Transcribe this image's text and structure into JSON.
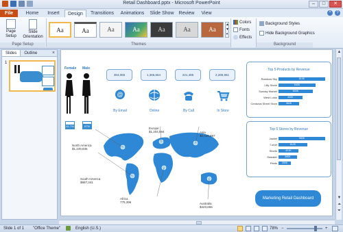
{
  "window": {
    "title": "Retail Dashboard.pptx - Microsoft PowerPoint",
    "minimize": "–",
    "maximize": "□",
    "close": "✕"
  },
  "ribbon_tabs": [
    "File",
    "Home",
    "Insert",
    "Design",
    "Transitions",
    "Animations",
    "Slide Show",
    "Review",
    "View"
  ],
  "ribbon": {
    "page_setup": {
      "btn1": "Page Setup",
      "btn2": "Slide Orientation",
      "group": "Page Setup"
    },
    "themes": {
      "group": "Themes",
      "sample": "Aa"
    },
    "theme_options": {
      "colors": "Colors",
      "fonts": "Fonts",
      "effects": "Effects"
    },
    "background": {
      "styles": "Background Styles",
      "hide": "Hide Background Graphics",
      "group": "Background"
    }
  },
  "left_pane": {
    "tab_slides": "Slides",
    "tab_outline": "Outline",
    "close": "×",
    "slide_number": "1"
  },
  "slide": {
    "female_label": "Female",
    "male_label": "Male",
    "female_pct": "61.7%",
    "male_pct": "67%",
    "female_fill": 0.617,
    "male_fill": 0.67,
    "channels": [
      {
        "value": "364,055",
        "label": "By Email",
        "icon": "email-icon"
      },
      {
        "value": "1,366,664",
        "label": "Online",
        "icon": "globe-icon"
      },
      {
        "value": "221,485",
        "label": "By Call",
        "icon": "phone-icon"
      },
      {
        "value": "2,285,961",
        "label": "In Store",
        "icon": "cart-icon"
      }
    ],
    "regions": [
      {
        "name": "North America",
        "value": "$1,249,835"
      },
      {
        "name": "Europe",
        "value": "$1,204,594"
      },
      {
        "name": "Asia",
        "value": "$2,025,897"
      },
      {
        "name": "South America",
        "value": "$987,341"
      },
      {
        "name": "Africa",
        "value": "775,396"
      },
      {
        "name": "Australia",
        "value": "$423,655"
      }
    ],
    "top_products": {
      "title": "Top 5 Products by Revenue",
      "items": [
        {
          "label": "Rainbow Sky",
          "value": "810K",
          "fraction": 1.0
        },
        {
          "label": "Lilly Stone",
          "value": "640K",
          "fraction": 0.79
        },
        {
          "label": "Sunday Market",
          "value": "600K",
          "fraction": 0.74
        },
        {
          "label": "West Lotus",
          "value": "420K",
          "fraction": 0.52
        },
        {
          "label": "Centurial Street Store",
          "value": "360K",
          "fraction": 0.44
        }
      ]
    },
    "top_stores": {
      "title": "Top 5 Stores by Revenue",
      "items": [
        {
          "label": "Jacket",
          "value": "980K",
          "fraction": 1.0
        },
        {
          "label": "T-shirt",
          "value": "610K",
          "fraction": 0.62
        },
        {
          "label": "Shorts",
          "value": "421K",
          "fraction": 0.43
        },
        {
          "label": "Sweater",
          "value": "380K",
          "fraction": 0.39
        },
        {
          "label": "Pants",
          "value": "250K",
          "fraction": 0.26
        }
      ]
    },
    "callout": "Marketing Retail Dashboard"
  },
  "status": {
    "slide": "Slide 1 of 1",
    "theme": "\"Office Theme\"",
    "language": "English (U.S.)",
    "zoom": "78%"
  }
}
